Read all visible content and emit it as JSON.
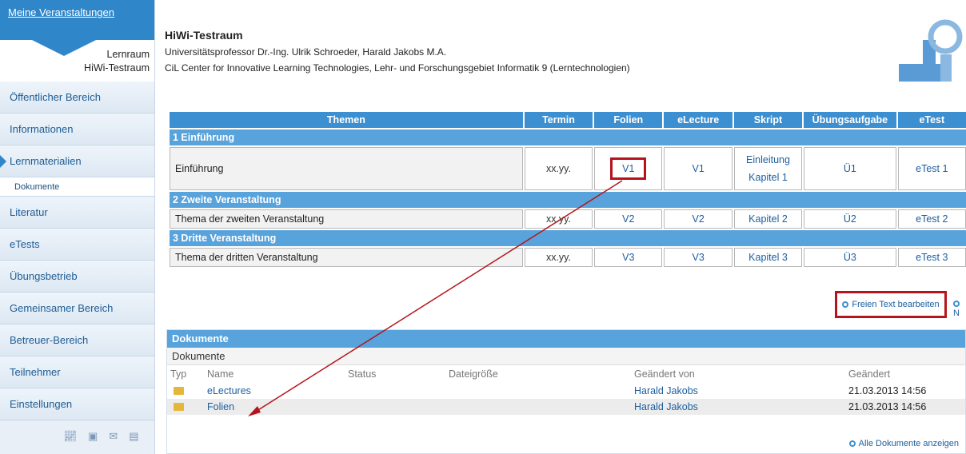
{
  "sidebar": {
    "header_link": "Meine Veranstaltungen",
    "course_line1": "Lernraum",
    "course_line2": "HiWi-Testraum",
    "items": [
      {
        "label": "Öffentlicher Bereich"
      },
      {
        "label": "Informationen"
      },
      {
        "label": "Lernmaterialien"
      },
      {
        "label": "Dokumente"
      },
      {
        "label": "Literatur"
      },
      {
        "label": "eTests"
      },
      {
        "label": "Übungsbetrieb"
      },
      {
        "label": "Gemeinsamer Bereich"
      },
      {
        "label": "Betreuer-Bereich"
      },
      {
        "label": "Teilnehmer"
      },
      {
        "label": "Einstellungen"
      }
    ],
    "footer_icons": [
      "chart-icon",
      "rss-icon",
      "mail-icon",
      "trash-icon"
    ]
  },
  "header": {
    "title": "HiWi-Testraum",
    "line1": "Universitätsprofessor Dr.-Ing. Ulrik Schroeder, Harald Jakobs M.A.",
    "line2": "CiL Center for Innovative Learning Technologies, Lehr- und Forschungsgebiet Informatik 9 (Lerntechnologien)"
  },
  "plan": {
    "columns": [
      "Themen",
      "Termin",
      "Folien",
      "eLecture",
      "Skript",
      "Übungsaufgabe",
      "eTest"
    ],
    "sections": [
      {
        "heading": "1 Einführung",
        "topic": "Einführung",
        "termin": "xx.yy.",
        "folien": "V1",
        "electure": "V1",
        "skript1": "Einleitung",
        "skript2": "Kapitel 1",
        "uebung": "Ü1",
        "etest": "eTest 1"
      },
      {
        "heading": "2 Zweite Veranstaltung",
        "topic": "Thema der zweiten Veranstaltung",
        "termin": "xx.yy.",
        "folien": "V2",
        "electure": "V2",
        "skript1": "Kapitel 2",
        "uebung": "Ü2",
        "etest": "eTest 2"
      },
      {
        "heading": "3 Dritte Veranstaltung",
        "topic": "Thema der dritten Veranstaltung",
        "termin": "xx.yy.",
        "folien": "V3",
        "electure": "V3",
        "skript1": "Kapitel 3",
        "uebung": "Ü3",
        "etest": "eTest 3"
      }
    ],
    "freitext_link": "Freien Text bearbeiten",
    "more_link": "N"
  },
  "documents": {
    "heading": "Dokumente",
    "subheading": "Dokumente",
    "columns": [
      "Typ",
      "Name",
      "Status",
      "Dateigröße",
      "Geändert von",
      "Geändert"
    ],
    "rows": [
      {
        "name": "eLectures",
        "by": "Harald Jakobs",
        "date": "21.03.2013 14:56"
      },
      {
        "name": "Folien",
        "by": "Harald Jakobs",
        "date": "21.03.2013 14:56"
      }
    ],
    "all_link": "Alle Dokumente anzeigen"
  },
  "colors": {
    "accent": "#3c8fd0",
    "highlight": "#b5141c"
  }
}
